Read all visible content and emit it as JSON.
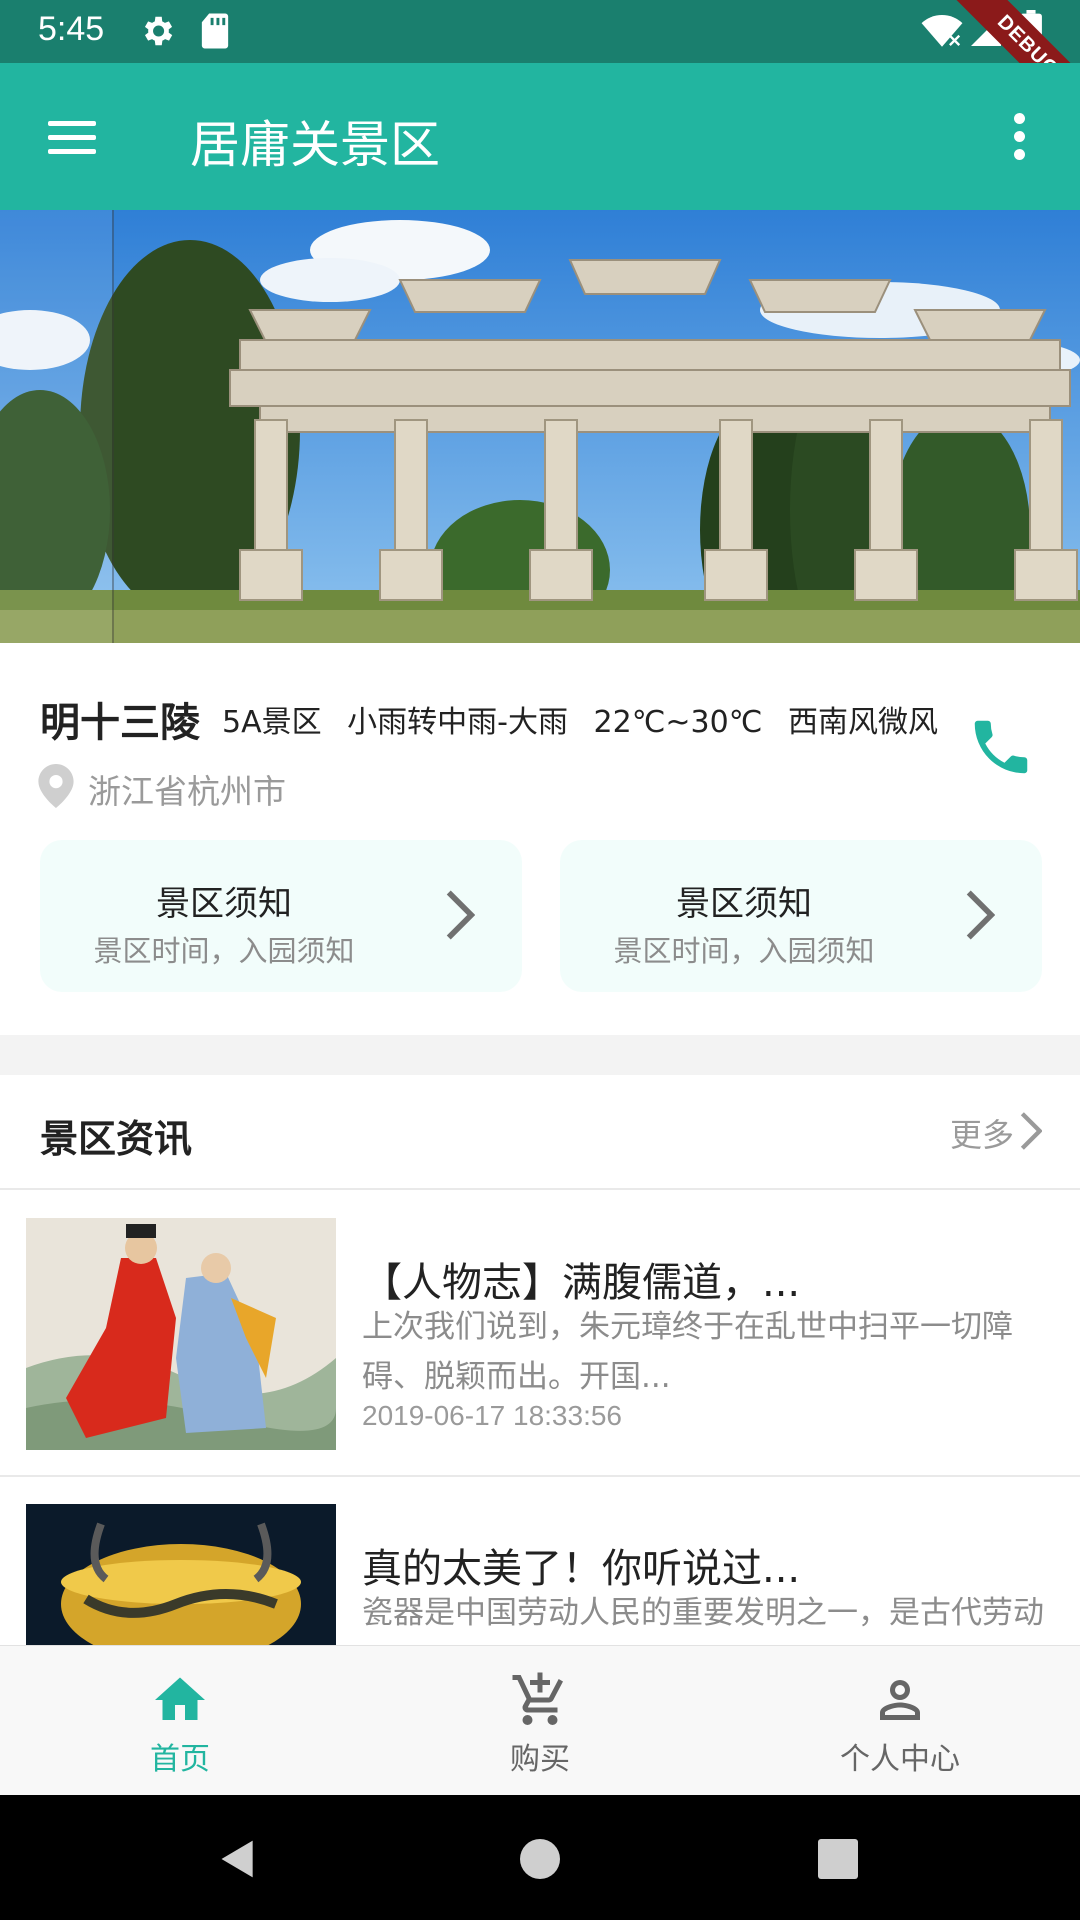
{
  "status_bar": {
    "time": "5:45",
    "debug_label": "DEBUG"
  },
  "app_bar": {
    "title": "居庸关景区"
  },
  "scenic": {
    "name": "明十三陵",
    "level": "5A景区",
    "weather": "小雨转中雨-大雨",
    "temperature": "22℃~30℃",
    "wind": "西南风微风",
    "location": "浙江省杭州市"
  },
  "notice_cards": [
    {
      "title": "景区须知",
      "subtitle": "景区时间，入园须知"
    },
    {
      "title": "景区须知",
      "subtitle": "景区时间，入园须知"
    }
  ],
  "news_section": {
    "header": "景区资讯",
    "more_label": "更多",
    "items": [
      {
        "title": "【人物志】满腹儒道，...",
        "desc": "上次我们说到，朱元璋终于在乱世中扫平一切障碍、脱颖而出。开国...",
        "date": "2019-06-17 18:33:56"
      },
      {
        "title": "真的太美了！你听说过...",
        "desc": "瓷器是中国劳动人民的重要发明之一，是古代劳动人民的智慧和力量"
      }
    ]
  },
  "bottom_nav": {
    "items": [
      {
        "label": "首页",
        "icon": "home-icon",
        "active": true
      },
      {
        "label": "购买",
        "icon": "cart-add-icon",
        "active": false
      },
      {
        "label": "个人中心",
        "icon": "person-icon",
        "active": false
      }
    ]
  },
  "colors": {
    "status_bar": "#1a7f6e",
    "app_bar": "#22b5a0",
    "accent": "#22b5a0",
    "inactive": "#666666"
  }
}
